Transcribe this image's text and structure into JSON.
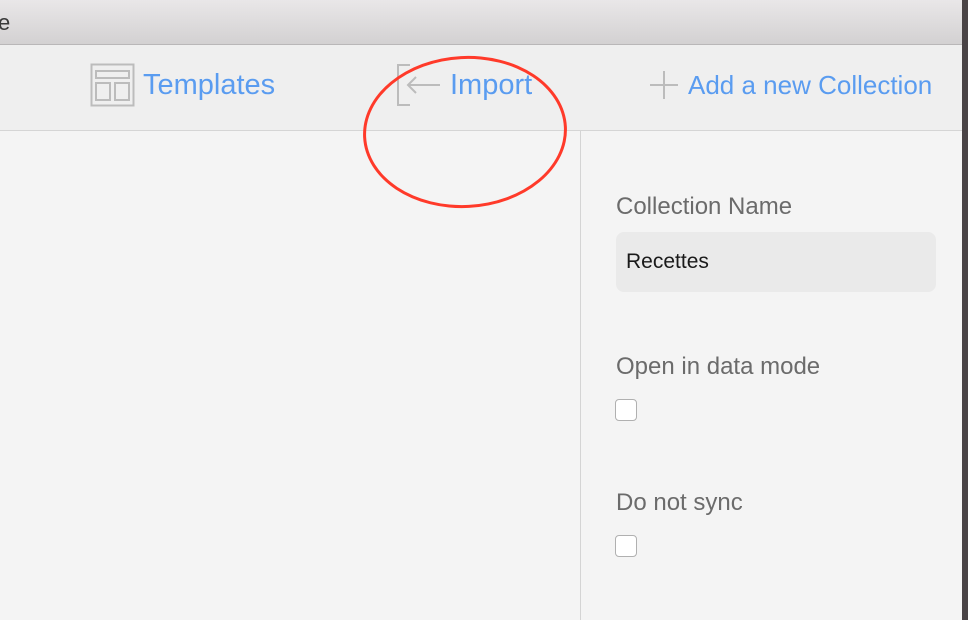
{
  "window": {
    "title_fragment": "e"
  },
  "toolbar": {
    "templates_label": "Templates",
    "import_label": "Import",
    "add_collection_label": "Add a new Collection",
    "icons": [
      "templates-icon",
      "import-icon",
      "plus-icon"
    ],
    "accent_color": "#5a9cf0"
  },
  "annotation": {
    "highlight_color": "#ff3a2a",
    "highlighted_item": "import"
  },
  "collection_panel": {
    "name_label": "Collection Name",
    "name_value": "Recettes",
    "open_data_mode_label": "Open in data mode",
    "open_data_mode_checked": false,
    "do_not_sync_label": "Do not sync",
    "do_not_sync_checked": false
  }
}
